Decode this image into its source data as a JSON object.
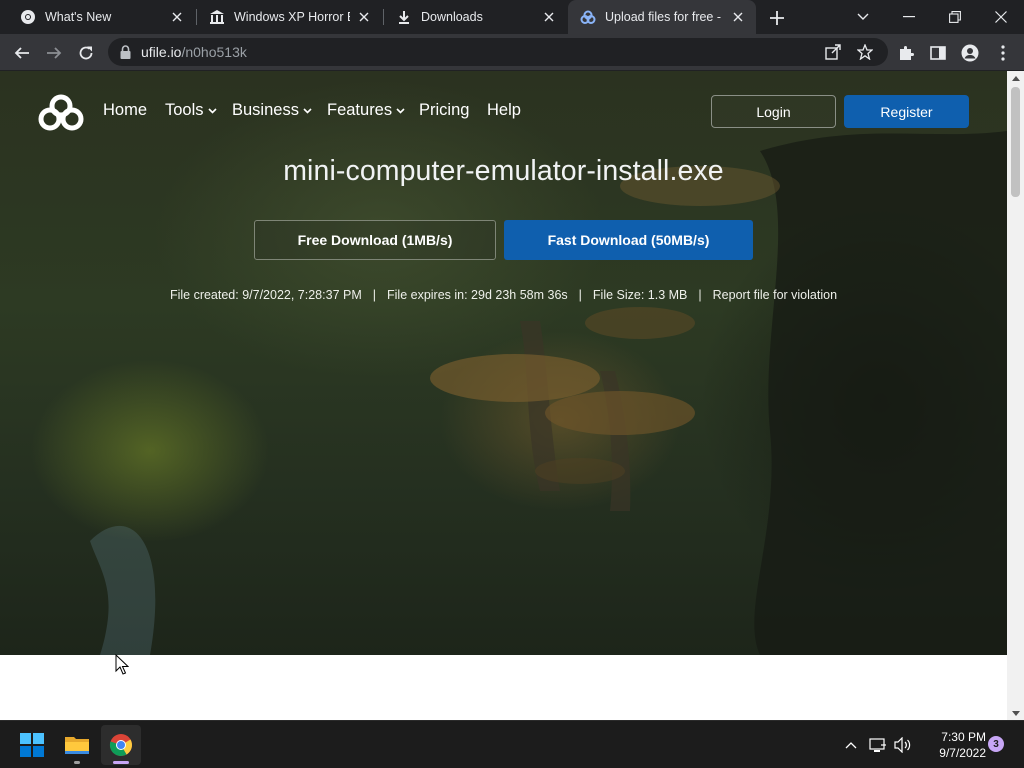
{
  "browser": {
    "tabs": [
      {
        "title": "What's New",
        "icon": "chrome-icon"
      },
      {
        "title": "Windows XP Horror Ed",
        "icon": "museum-icon"
      },
      {
        "title": "Downloads",
        "icon": "download-icon"
      },
      {
        "title": "Upload files for free - n",
        "icon": "ufile-icon",
        "active": true
      }
    ],
    "address": {
      "host": "ufile.io",
      "path": "/n0ho513k"
    }
  },
  "site": {
    "nav": [
      {
        "label": "Home",
        "dropdown": false
      },
      {
        "label": "Tools",
        "dropdown": true
      },
      {
        "label": "Business",
        "dropdown": true
      },
      {
        "label": "Features",
        "dropdown": true
      },
      {
        "label": "Pricing",
        "dropdown": false
      },
      {
        "label": "Help",
        "dropdown": false
      }
    ],
    "login_label": "Login",
    "register_label": "Register",
    "filename": "mini-computer-emulator-install.exe",
    "free_download_label": "Free Download (1MB/s)",
    "fast_download_label": "Fast Download (50MB/s)",
    "meta": {
      "created": "File created: 9/7/2022, 7:28:37 PM",
      "expires": "File expires in: 29d 23h 58m 36s",
      "size": "File Size: 1.3 MB",
      "report": "Report file for violation",
      "separator": "|"
    },
    "accent_color": "#0f5fae"
  },
  "taskbar": {
    "apps": [
      "start-icon",
      "file-explorer-icon",
      "chrome-icon"
    ],
    "time": "7:30 PM",
    "date": "9/7/2022",
    "notification_count": "3"
  }
}
